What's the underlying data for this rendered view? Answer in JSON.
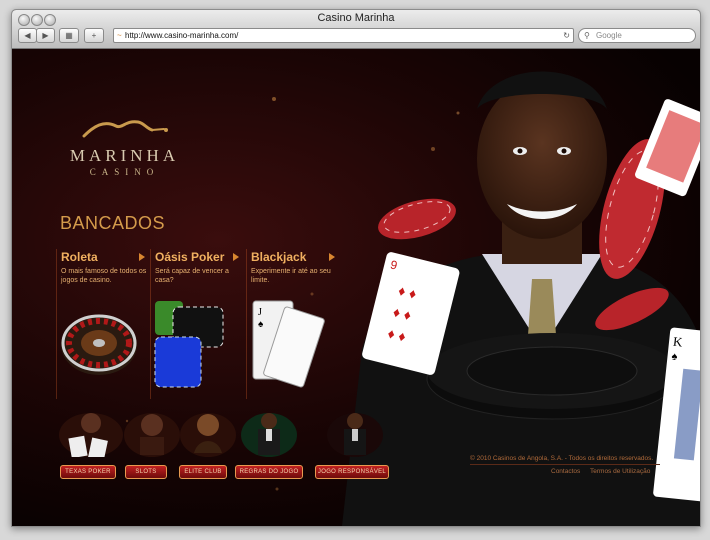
{
  "browser": {
    "window_title": "Casino Marinha",
    "url": "http://www.casino-marinha.com/",
    "search_placeholder": "Google"
  },
  "logo": {
    "name": "MARINHA",
    "sub": "CASINO"
  },
  "section_title": "BANCADOS",
  "games": [
    {
      "title": "Roleta",
      "description": "O mais famoso de todos os jogos de casino."
    },
    {
      "title": "Oásis Poker",
      "description": "Será capaz de vencer a casa?"
    },
    {
      "title": "Blackjack",
      "description": "Experimente ir até ao seu limite."
    }
  ],
  "bottom_nav": [
    {
      "label": "TEXAS POKER"
    },
    {
      "label": "SLOTS"
    },
    {
      "label": "ELITE CLUB"
    },
    {
      "label": "REGRAS DO JOGO"
    },
    {
      "label": "JOGO RESPONSÁVEL"
    }
  ],
  "footer": {
    "copyright": "© 2010 Casinos de Angola, S.A. - Todos os direitos reservados.",
    "links": [
      "Contactos",
      "Termos de Utilização"
    ]
  },
  "colors": {
    "accent_gold": "#d49b4b",
    "brand_red": "#c22020",
    "background": "#1b0505"
  }
}
